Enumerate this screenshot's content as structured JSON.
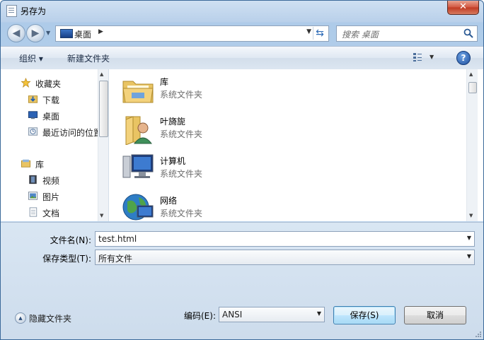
{
  "window": {
    "title": "另存为",
    "close_label": "✕"
  },
  "nav": {
    "address": {
      "location": "桌面"
    },
    "search": {
      "placeholder": "搜索 桌面"
    }
  },
  "toolbar": {
    "organize_label": "组织 ▾",
    "new_folder_label": "新建文件夹",
    "help_label": "?"
  },
  "sidebar": {
    "items": [
      {
        "label": "收藏夹",
        "icon": "star-icon"
      },
      {
        "label": "下载",
        "icon": "download-folder-icon"
      },
      {
        "label": "桌面",
        "icon": "desktop-icon"
      },
      {
        "label": "最近访问的位置",
        "icon": "recent-places-icon"
      },
      {
        "label": "库",
        "icon": "library-icon"
      },
      {
        "label": "视频",
        "icon": "video-icon"
      },
      {
        "label": "图片",
        "icon": "pictures-icon"
      },
      {
        "label": "文档",
        "icon": "documents-icon"
      }
    ]
  },
  "files": [
    {
      "name": "库",
      "type": "系统文件夹",
      "icon": "library-folder-icon"
    },
    {
      "name": "叶旖旎",
      "type": "系统文件夹",
      "icon": "user-folder-icon"
    },
    {
      "name": "计算机",
      "type": "系统文件夹",
      "icon": "computer-icon"
    },
    {
      "name": "网络",
      "type": "系统文件夹",
      "icon": "network-icon"
    }
  ],
  "form": {
    "filename_label": "文件名(N):",
    "filename_value": "test.html",
    "filetype_label": "保存类型(T):",
    "filetype_value": "所有文件",
    "encoding_label": "编码(E):",
    "encoding_value": "ANSI"
  },
  "footer": {
    "hide_folders_label": "隐藏文件夹",
    "save_label": "保存(S)",
    "cancel_label": "取消"
  },
  "colors": {
    "titlebar": "#c5d9ee",
    "selection_accent": "#3c7fb1",
    "close_button": "#c03a22"
  }
}
